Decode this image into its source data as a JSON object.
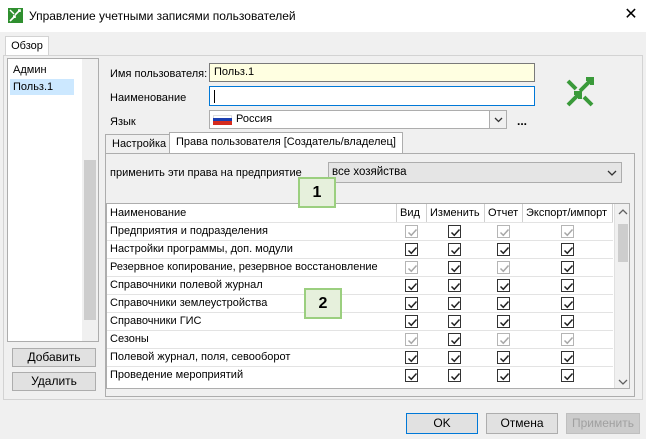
{
  "window": {
    "title": "Управление учетными записями пользователей",
    "close_glyph": "✕"
  },
  "main_tab": "Обзор",
  "users": [
    "Админ",
    "Польз.1"
  ],
  "selected_user_index": 1,
  "buttons": {
    "add": "Добавить",
    "delete": "Удалить",
    "ok": "OK",
    "cancel": "Отмена",
    "apply": "Применить"
  },
  "form": {
    "username_label": "Имя пользователя:",
    "username_value": "Польз.1",
    "name_label": "Наименование",
    "name_value": "",
    "language_label": "Язык",
    "language_value": "Россия",
    "more_glyph": "..."
  },
  "sub_tabs": [
    "Настройка",
    "Права пользователя [Создатель/владелец]"
  ],
  "active_sub_tab": 1,
  "apply_rights": {
    "label": "применить эти права на предприятие",
    "value": "все хозяйства"
  },
  "table": {
    "columns": [
      "Наименование",
      "Вид",
      "Изменить",
      "Отчет",
      "Экспорт/импорт"
    ],
    "rows": [
      {
        "name": "Предприятия и подразделения",
        "vid": "checked-disabled",
        "izm": "checked",
        "otch": "checked-disabled",
        "exp": "checked-disabled"
      },
      {
        "name": "Настройки программы, доп. модули",
        "vid": "checked",
        "izm": "checked",
        "otch": "checked",
        "exp": "checked"
      },
      {
        "name": "Резервное копирование, резервное восстановление",
        "vid": "checked-disabled",
        "izm": "checked",
        "otch": "checked-disabled",
        "exp": "checked"
      },
      {
        "name": "Справочники полевой журнал",
        "vid": "checked",
        "izm": "checked",
        "otch": "checked",
        "exp": "checked"
      },
      {
        "name": "Справочники землеустройства",
        "vid": "checked",
        "izm": "checked",
        "otch": "checked",
        "exp": "checked"
      },
      {
        "name": "Справочники ГИС",
        "vid": "checked",
        "izm": "checked",
        "otch": "checked",
        "exp": "checked"
      },
      {
        "name": "Сезоны",
        "vid": "checked-disabled",
        "izm": "checked",
        "otch": "checked-disabled",
        "exp": "checked-disabled"
      },
      {
        "name": "Полевой журнал, поля, севооборот",
        "vid": "checked",
        "izm": "checked",
        "otch": "checked",
        "exp": "checked"
      },
      {
        "name": "Проведение мероприятий",
        "vid": "checked",
        "izm": "checked",
        "otch": "checked",
        "exp": "checked"
      }
    ]
  },
  "callouts": [
    "1",
    "2"
  ],
  "colors": {
    "selection": "#cce8ff",
    "highlight_field": "#ffffe1",
    "focus_border": "#0078d7",
    "logo_green": "#3a9a3a",
    "callout_border": "#9bcf7f"
  }
}
